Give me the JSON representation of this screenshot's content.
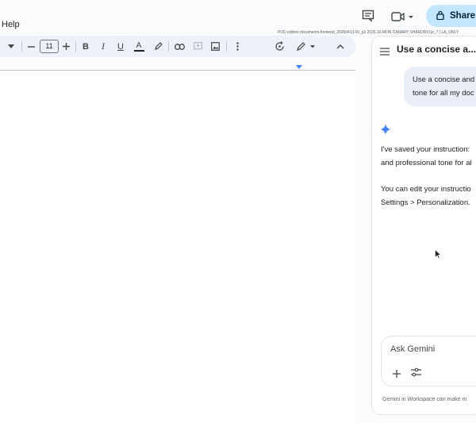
{
  "menubar": {
    "help_label": "Help"
  },
  "header": {
    "share_label": "Share",
    "build_info": "POD editors documents-frontend_20260413.00_p2 2026.16-MON CANARY SHARD003 je_7 | LA_ONLY"
  },
  "toolbar": {
    "font_size": "11",
    "text_color_accent": "#1f1f1f"
  },
  "gemini": {
    "panel_title": "Use a concise a...",
    "user_message_lines": [
      "Use a concise and",
      "tone for all my doc"
    ],
    "response_lines": [
      "I've saved your instruction:",
      "and professional tone for al"
    ],
    "followup_lines": [
      "You can edit your instructio",
      "Settings > Personalization."
    ],
    "ask_placeholder": "Ask Gemini",
    "disclaimer": "Gemini in Workspace can make m"
  },
  "colors": {
    "accent": "#c2e7ff",
    "spark": "#4285f4",
    "toolbar_bg": "#edf2fa"
  }
}
